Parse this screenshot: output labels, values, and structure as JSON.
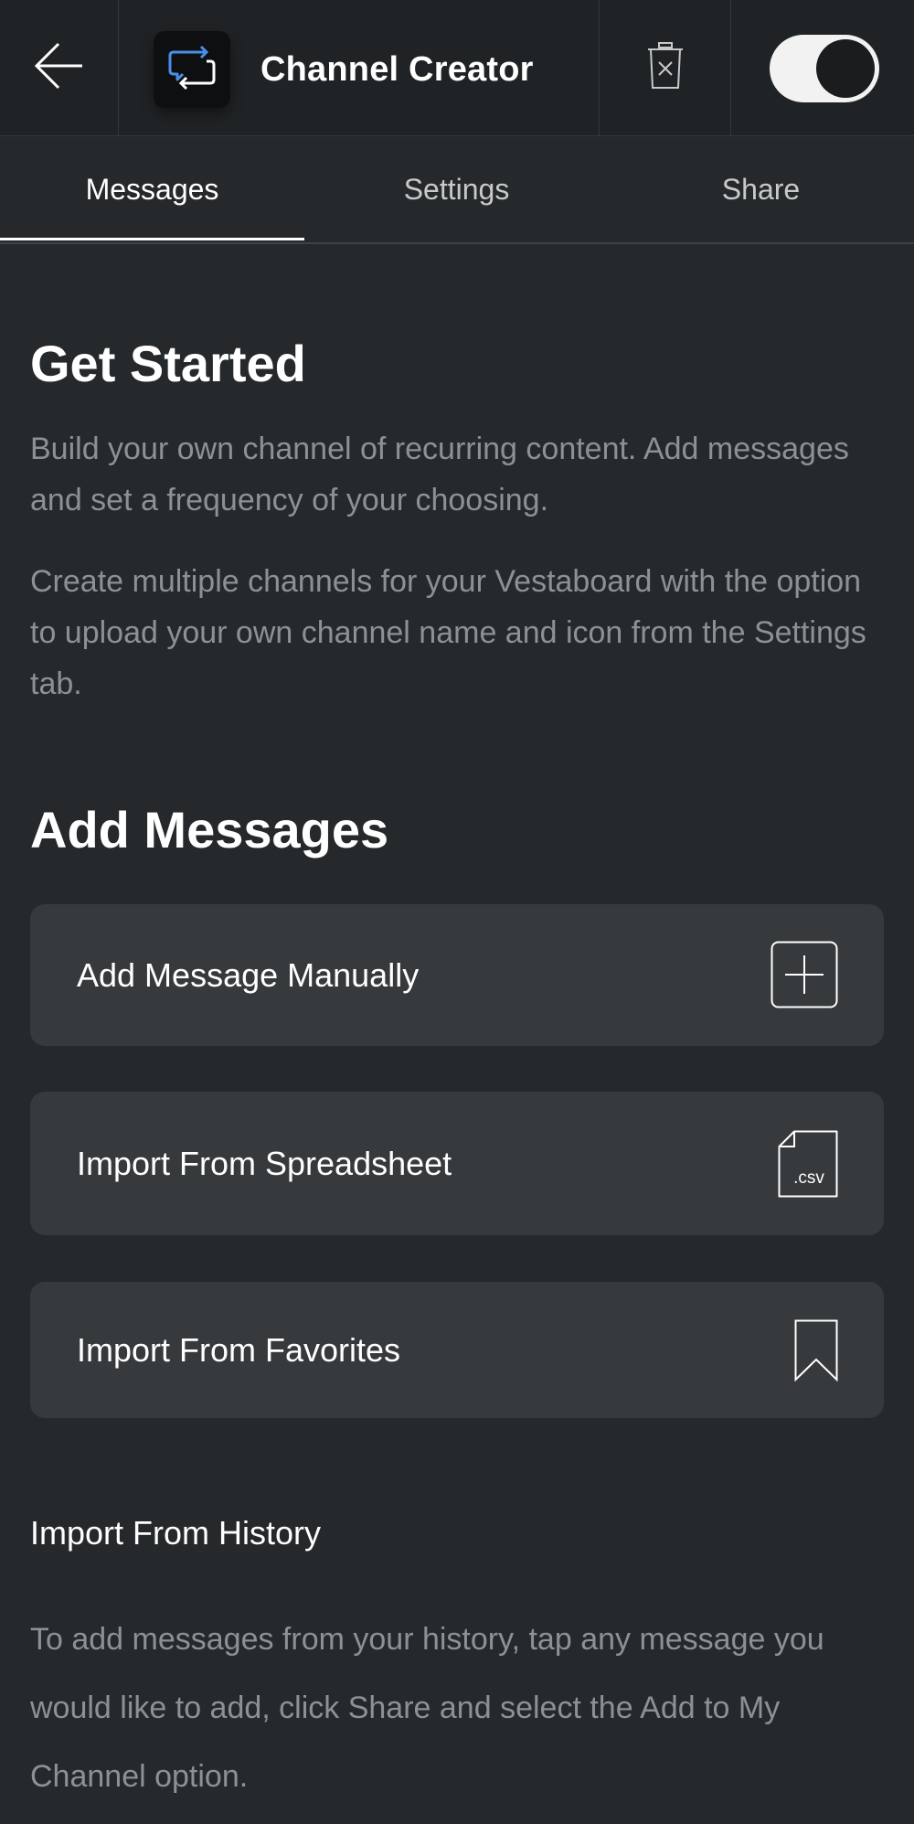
{
  "header": {
    "title": "Channel Creator",
    "back_icon": "back-arrow-icon",
    "channel_icon": "repeat-message-icon",
    "delete_icon": "trash-icon",
    "toggle_on": true
  },
  "tabs": [
    {
      "label": "Messages",
      "active": true
    },
    {
      "label": "Settings",
      "active": false
    },
    {
      "label": "Share",
      "active": false
    }
  ],
  "get_started": {
    "heading": "Get Started",
    "paragraph1": "Build your own channel of recurring content. Add messages and set a frequency of your choosing.",
    "paragraph2": "Create multiple channels for your Vestaboard with the option to upload your own channel name and icon from the Settings tab."
  },
  "add_messages": {
    "heading": "Add Messages",
    "options": [
      {
        "label": "Add Message Manually",
        "icon": "plus-square-icon"
      },
      {
        "label": "Import From Spreadsheet",
        "icon": "csv-file-icon",
        "icon_text": ".csv"
      },
      {
        "label": "Import From Favorites",
        "icon": "bookmark-icon"
      }
    ]
  },
  "history": {
    "heading": "Import From History",
    "description": "To add messages from your history, tap any message you would like to add, click Share and select the Add to My Channel option."
  },
  "colors": {
    "background": "#25292b",
    "header_background": "#202325",
    "card_background": "#363a3d",
    "muted_text": "#8c9194",
    "accent_blue": "#4a8fe7"
  }
}
